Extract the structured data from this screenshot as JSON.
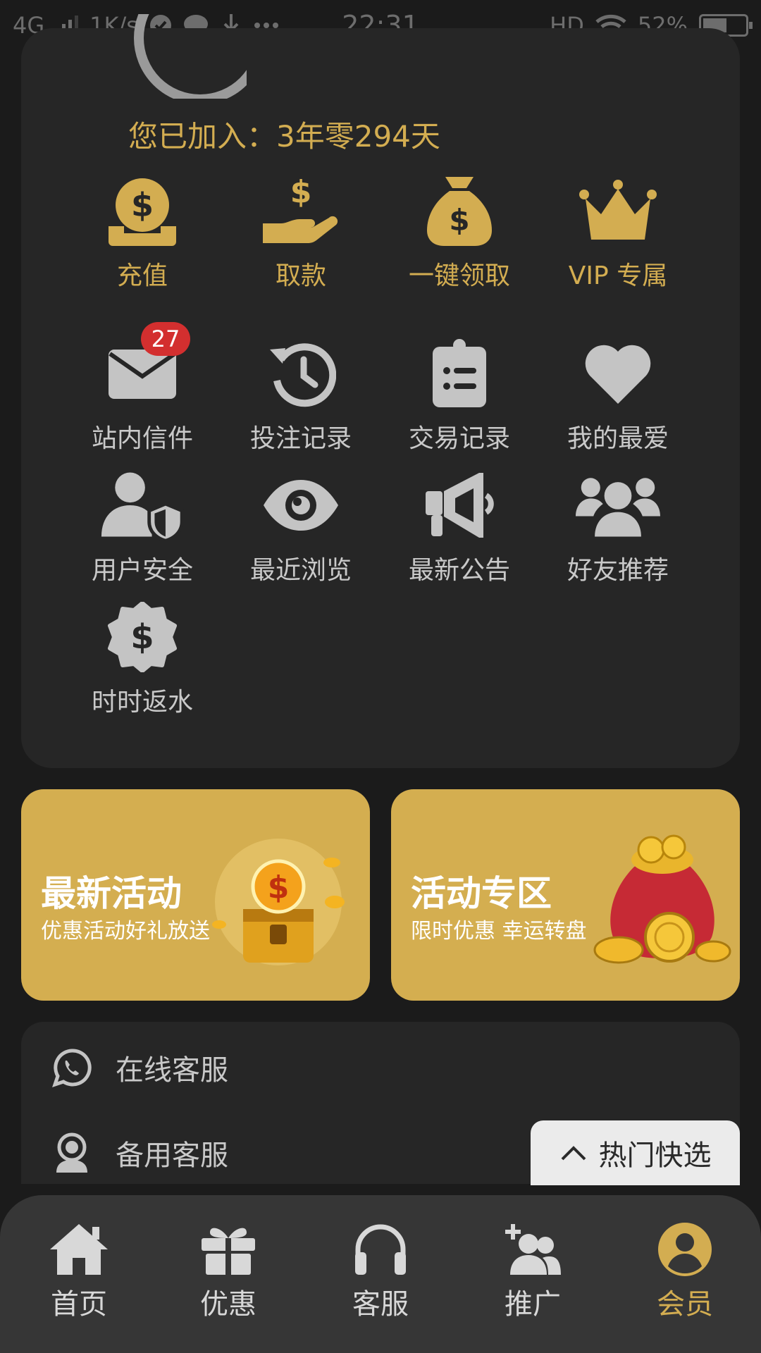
{
  "status_bar": {
    "network": "4G",
    "speed": "1K/s",
    "time": "22:31",
    "hd": "HD",
    "battery": "52%"
  },
  "member": {
    "joined_label": "您已加入：3年零294天"
  },
  "gold_actions": [
    {
      "label": "充值",
      "icon": "deposit-icon"
    },
    {
      "label": "取款",
      "icon": "withdraw-icon"
    },
    {
      "label": "一键领取",
      "icon": "money-bag-icon"
    },
    {
      "label": "VIP 专属",
      "icon": "crown-icon"
    }
  ],
  "menu_items": [
    {
      "label": "站内信件",
      "icon": "mail-icon",
      "badge": "27"
    },
    {
      "label": "投注记录",
      "icon": "history-icon"
    },
    {
      "label": "交易记录",
      "icon": "clipboard-icon"
    },
    {
      "label": "我的最爱",
      "icon": "heart-icon"
    },
    {
      "label": "用户安全",
      "icon": "user-shield-icon"
    },
    {
      "label": "最近浏览",
      "icon": "eye-icon"
    },
    {
      "label": "最新公告",
      "icon": "megaphone-icon"
    },
    {
      "label": "好友推荐",
      "icon": "users-icon"
    },
    {
      "label": "时时返水",
      "icon": "dollar-badge-icon"
    }
  ],
  "promos": [
    {
      "title": "最新活动",
      "subtitle": "优惠活动好礼放送"
    },
    {
      "title": "活动专区",
      "subtitle": "限时优惠 幸运转盘"
    }
  ],
  "support": [
    {
      "label": "在线客服",
      "icon": "whatsapp-icon"
    },
    {
      "label": "备用客服",
      "icon": "support-agent-icon"
    }
  ],
  "hot_button": {
    "label": "热门快选"
  },
  "bottom_nav": [
    {
      "label": "首页",
      "icon": "home-icon"
    },
    {
      "label": "优惠",
      "icon": "gift-icon"
    },
    {
      "label": "客服",
      "icon": "headphones-icon"
    },
    {
      "label": "推广",
      "icon": "add-user-icon"
    },
    {
      "label": "会员",
      "icon": "profile-icon",
      "active": true
    }
  ],
  "colors": {
    "background": "#1b1b1b",
    "card": "#262626",
    "gold": "#d3ad51",
    "gray_icon": "#c4c4c4",
    "badge": "#d32f2f",
    "nav": "#363636"
  }
}
